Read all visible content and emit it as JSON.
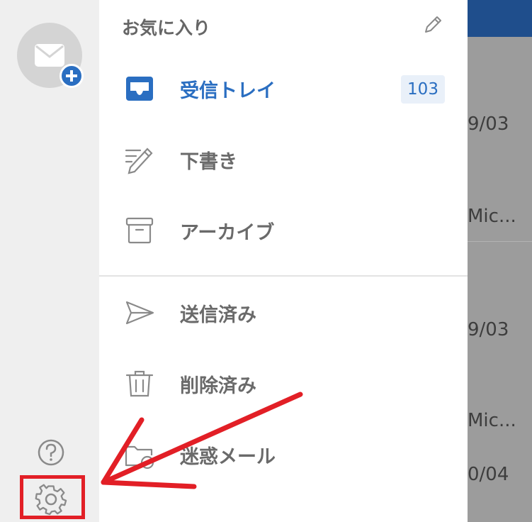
{
  "background": {
    "list_fragments": [
      "9/03",
      "Mic...",
      "9/03",
      "Mic...",
      "0/04"
    ]
  },
  "rail": {
    "help_icon": "question-circle-icon",
    "settings_icon": "gear-icon",
    "avatar_icon": "mail-icon"
  },
  "drawer": {
    "title": "お気に入り",
    "edit_icon": "pencil-icon",
    "inbox": {
      "label": "受信トレイ",
      "count": "103"
    },
    "drafts": {
      "label": "下書き"
    },
    "archive": {
      "label": "アーカイブ"
    },
    "sent": {
      "label": "送信済み"
    },
    "deleted": {
      "label": "削除済み"
    },
    "junk": {
      "label": "迷惑メール"
    }
  },
  "colors": {
    "accent": "#2a6ec1",
    "annotation": "#e21f26",
    "header": "#1f4e8c"
  }
}
